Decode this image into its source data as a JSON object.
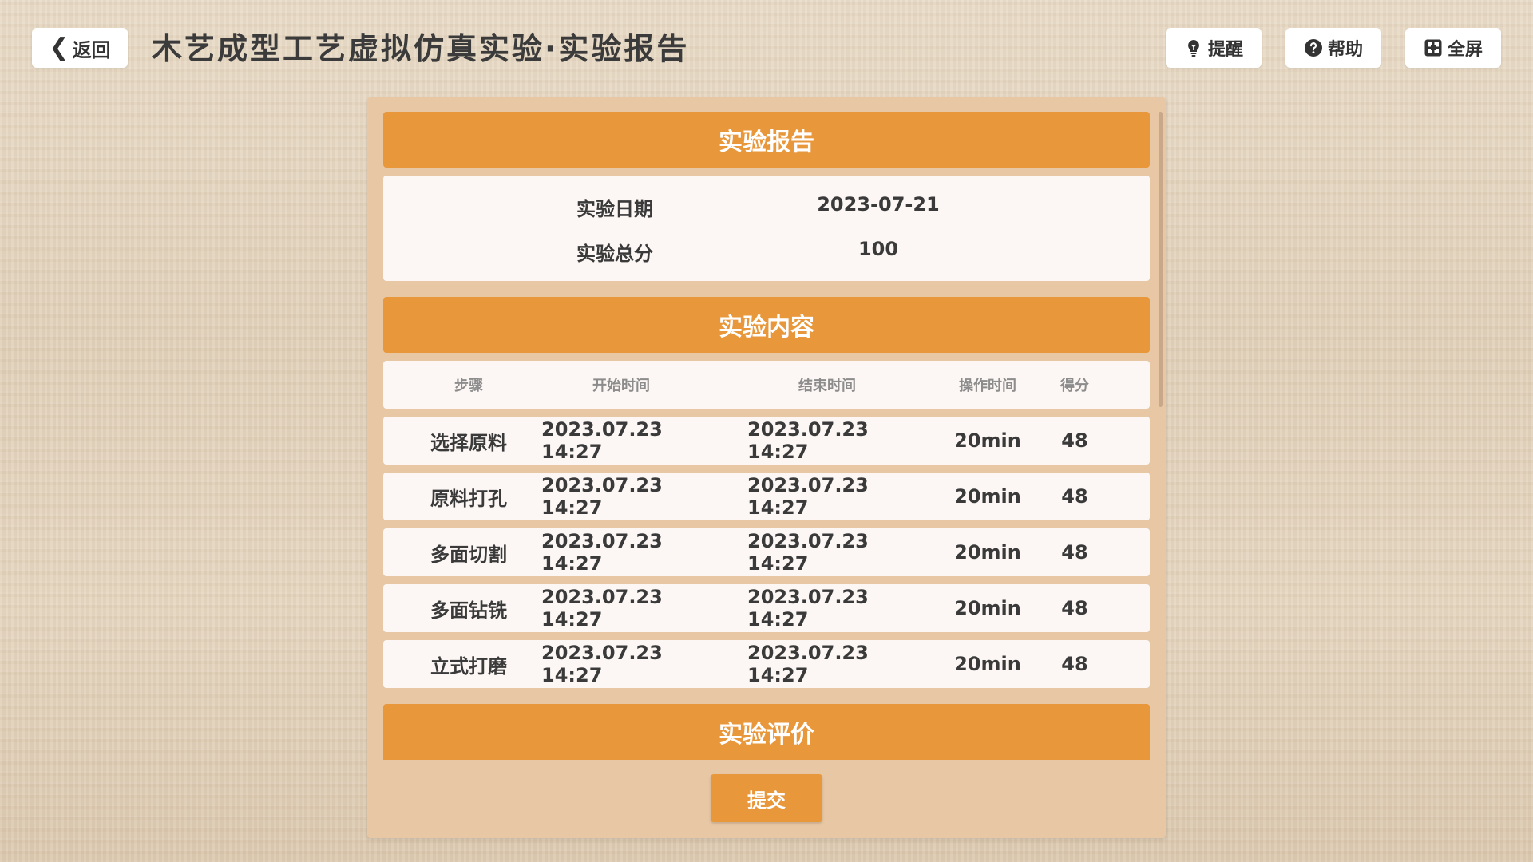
{
  "header": {
    "back_label": "返回",
    "title": "木艺成型工艺虚拟仿真实验·实验报告",
    "tools": [
      {
        "label": "提醒",
        "icon": "lightbulb-icon"
      },
      {
        "label": "帮助",
        "icon": "help-icon"
      },
      {
        "label": "全屏",
        "icon": "fullscreen-icon"
      }
    ]
  },
  "report": {
    "section_title": "实验报告",
    "info": [
      {
        "label": "实验日期",
        "value": "2023-07-21"
      },
      {
        "label": "实验总分",
        "value": "100"
      }
    ]
  },
  "content": {
    "section_title": "实验内容",
    "columns": [
      "步骤",
      "开始时间",
      "结束时间",
      "操作时间",
      "得分"
    ],
    "rows": [
      {
        "step": "选择原料",
        "start": "2023.07.23 14:27",
        "end": "2023.07.23 14:27",
        "duration": "20min",
        "score": "48"
      },
      {
        "step": "原料打孔",
        "start": "2023.07.23 14:27",
        "end": "2023.07.23 14:27",
        "duration": "20min",
        "score": "48"
      },
      {
        "step": "多面切割",
        "start": "2023.07.23 14:27",
        "end": "2023.07.23 14:27",
        "duration": "20min",
        "score": "48"
      },
      {
        "step": "多面钻铣",
        "start": "2023.07.23 14:27",
        "end": "2023.07.23 14:27",
        "duration": "20min",
        "score": "48"
      },
      {
        "step": "立式打磨",
        "start": "2023.07.23 14:27",
        "end": "2023.07.23 14:27",
        "duration": "20min",
        "score": "48"
      }
    ]
  },
  "evaluation": {
    "section_title": "实验评价"
  },
  "submit_label": "提交",
  "colors": {
    "accent": "#e8973b",
    "card_bg": "#e8c7a4",
    "row_bg": "#fcf7f4"
  }
}
